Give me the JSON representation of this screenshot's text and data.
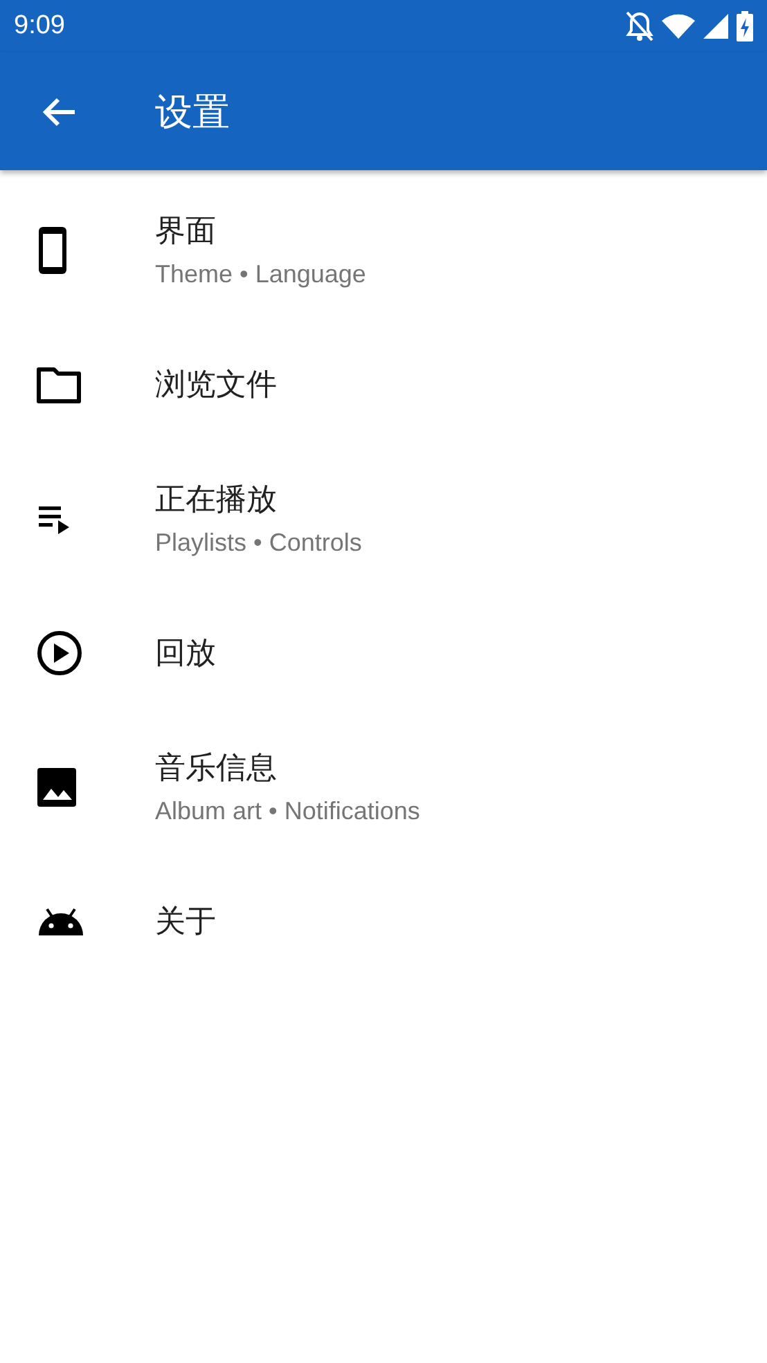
{
  "status_bar": {
    "time": "9:09"
  },
  "app_bar": {
    "title": "设置"
  },
  "items": [
    {
      "kind": "phone",
      "title": "界面",
      "subtitle": "Theme • Language"
    },
    {
      "kind": "folder",
      "title": "浏览文件"
    },
    {
      "kind": "queue",
      "title": "正在播放",
      "subtitle": "Playlists • Controls"
    },
    {
      "kind": "play",
      "title": "回放"
    },
    {
      "kind": "image",
      "title": "音乐信息",
      "subtitle": "Album art • Notifications"
    },
    {
      "kind": "android",
      "title": "关于"
    }
  ]
}
